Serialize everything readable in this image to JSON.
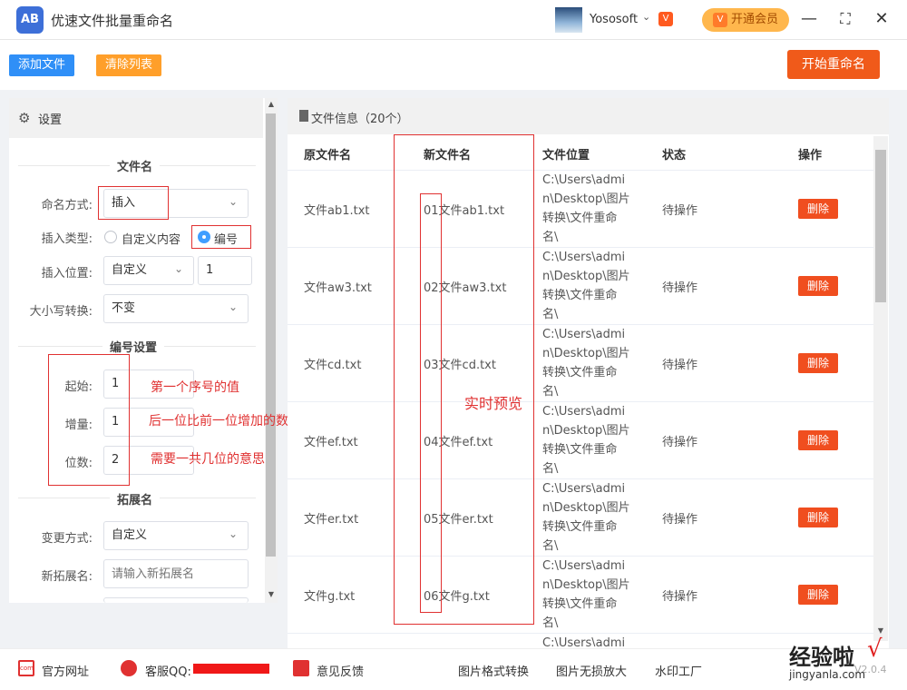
{
  "app": {
    "logo_text": "AB",
    "title": "优速文件批量重命名"
  },
  "user": {
    "name": "Yososoft",
    "vip_badge": "V",
    "vip_button": "开通会员"
  },
  "window": {
    "minimize": "—",
    "maximize": "⛶",
    "close": "✕"
  },
  "toolbar": {
    "add_files": "添加文件",
    "clear_list": "清除列表",
    "start_rename": "开始重命名"
  },
  "settings": {
    "title": "设置",
    "filename_section": "文件名",
    "naming_mode_label": "命名方式:",
    "naming_mode_value": "插入",
    "insert_type_label": "插入类型:",
    "insert_type_options": [
      "自定义内容",
      "编号"
    ],
    "insert_type_selected": "编号",
    "insert_pos_label": "插入位置:",
    "insert_pos_value": "自定义",
    "insert_pos_number": "1",
    "case_label": "大小写转换:",
    "case_value": "不变",
    "numbering_section": "编号设置",
    "start_label": "起始:",
    "start_value": "1",
    "step_label": "增量:",
    "step_value": "1",
    "digits_label": "位数:",
    "digits_value": "2",
    "ext_section": "拓展名",
    "ext_mode_label": "变更方式:",
    "ext_mode_value": "自定义",
    "new_ext_label": "新拓展名:",
    "new_ext_placeholder": "请输入新拓展名"
  },
  "annotations": {
    "start_note": "第一个序号的值",
    "step_note": "后一位比前一位增加的数值",
    "digits_note": "需要一共几位的意思",
    "preview_note": "实时预览"
  },
  "files": {
    "title": "文件信息（20个）",
    "columns": [
      "原文件名",
      "新文件名",
      "文件位置",
      "状态",
      "操作"
    ],
    "location_lines": [
      "C:\\Users\\admi",
      "n\\Desktop\\图片",
      "转换\\文件重命",
      "名\\"
    ],
    "status": "待操作",
    "delete_label": "删除",
    "rows": [
      {
        "original": "文件ab1.txt",
        "new": "01文件ab1.txt"
      },
      {
        "original": "文件aw3.txt",
        "new": "02文件aw3.txt"
      },
      {
        "original": "文件cd.txt",
        "new": "03文件cd.txt"
      },
      {
        "original": "文件ef.txt",
        "new": "04文件ef.txt"
      },
      {
        "original": "文件er.txt",
        "new": "05文件er.txt"
      },
      {
        "original": "文件g.txt",
        "new": "06文件g.txt"
      }
    ],
    "partial_next_location": "C:\\Users\\admi"
  },
  "footer": {
    "website": "官方网址",
    "qq": "客服QQ:",
    "feedback": "意见反馈",
    "image_convert": "图片格式转换",
    "image_enlarge": "图片无损放大",
    "watermark_factory": "水印工厂",
    "version": "V2.0.4"
  },
  "watermark": {
    "main": "经验啦",
    "check": "√",
    "sub": "jingyanla.com"
  }
}
